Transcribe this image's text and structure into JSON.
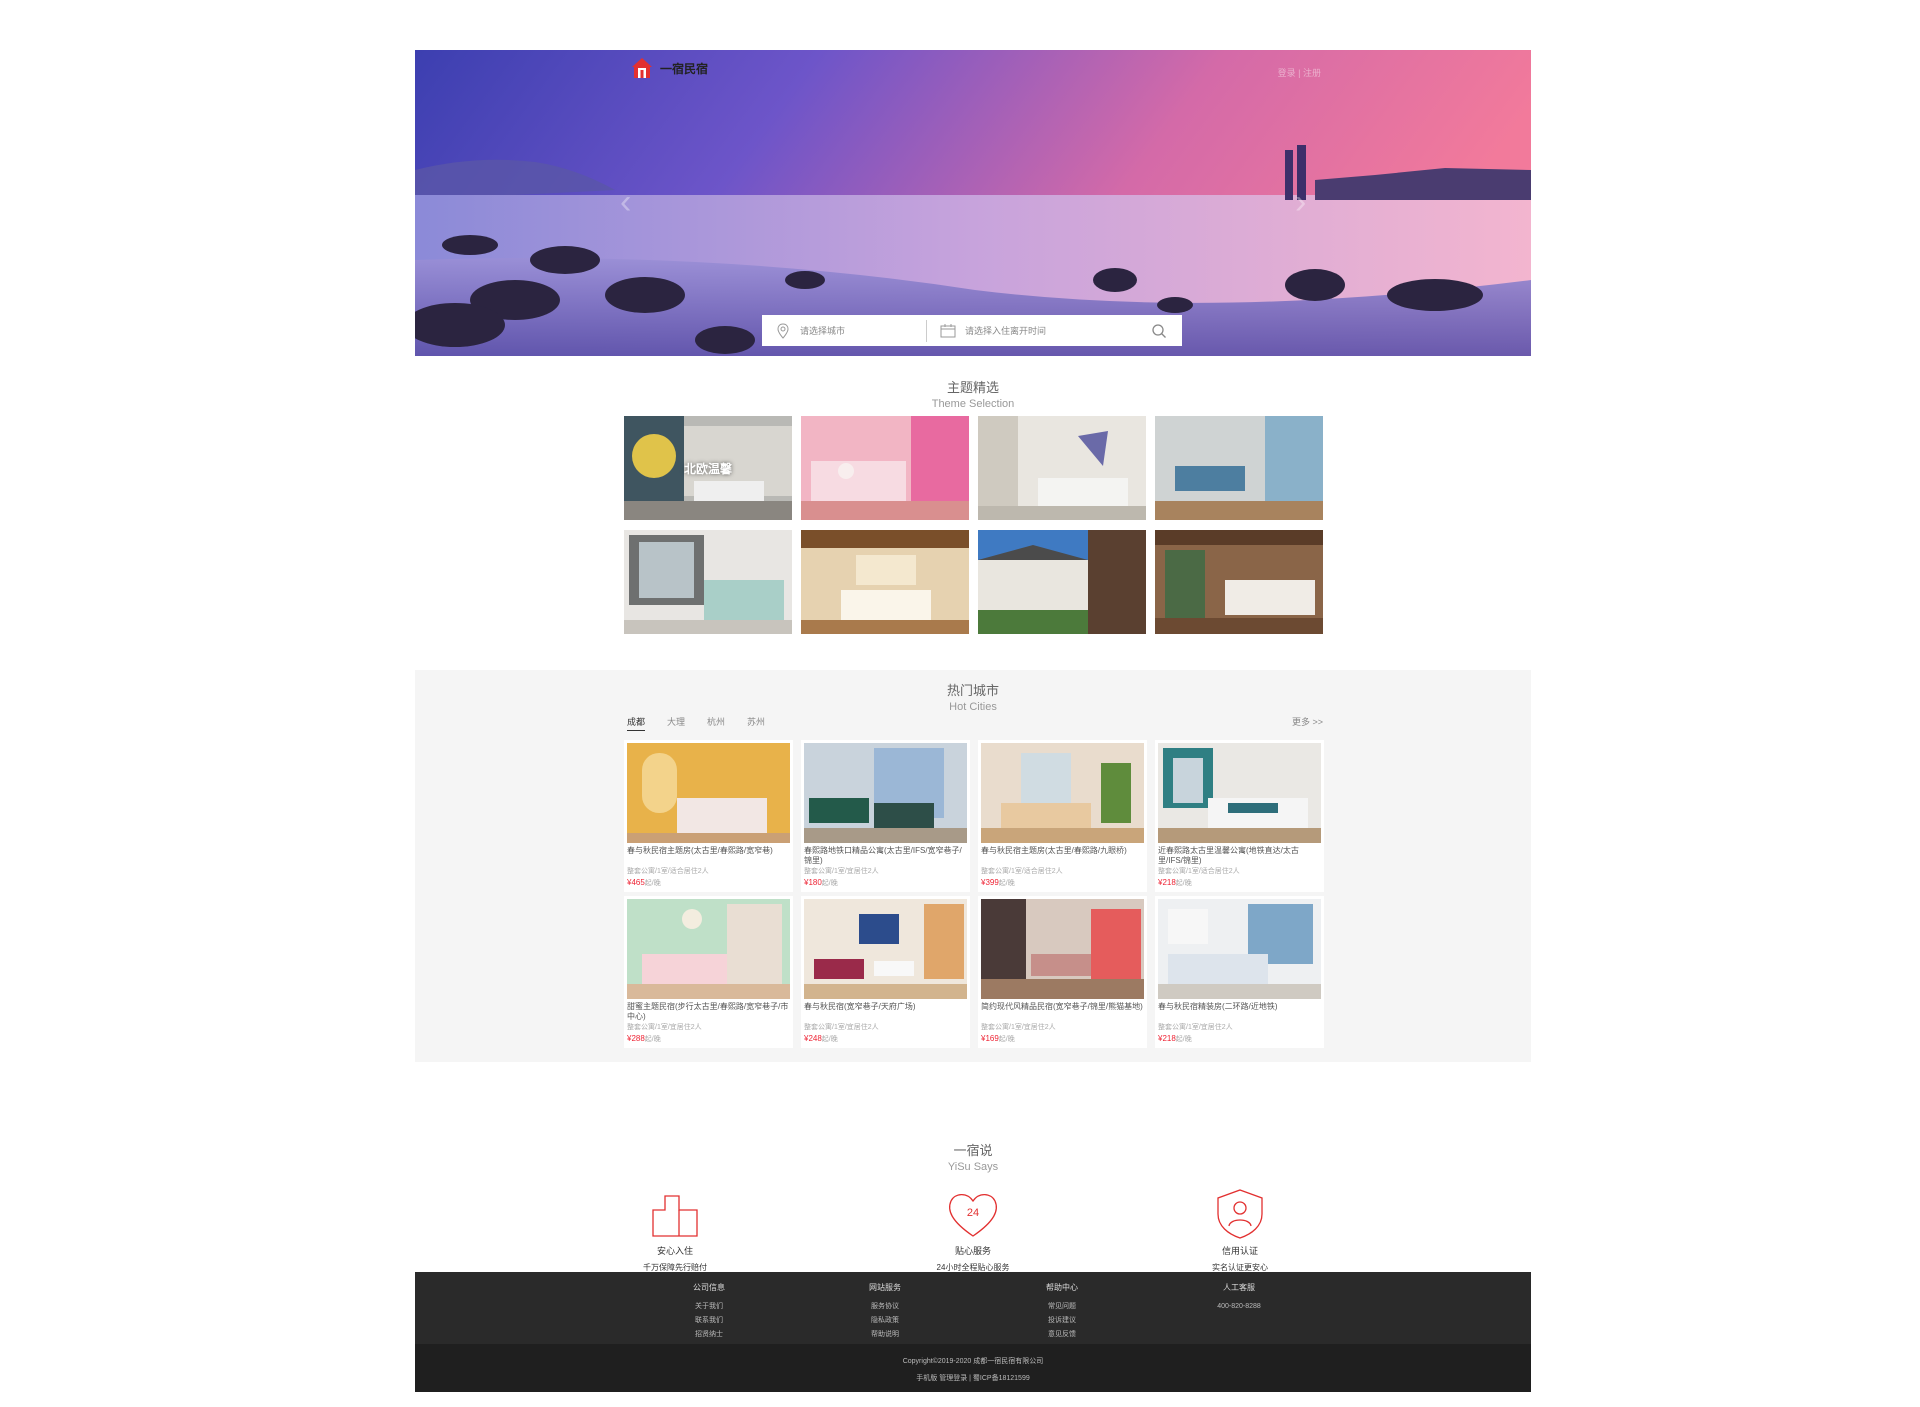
{
  "header": {
    "logo_text": "一宿民宿",
    "top_links": "登录 | 注册"
  },
  "search": {
    "city_placeholder": "请选择城市",
    "date_placeholder": "请选择入住离开时间"
  },
  "theme_section": {
    "title_cn": "主题精选",
    "title_en": "Theme Selection",
    "items": [
      {
        "label": "北欧温馨"
      },
      {
        "label": ""
      },
      {
        "label": ""
      },
      {
        "label": ""
      },
      {
        "label": ""
      },
      {
        "label": ""
      },
      {
        "label": ""
      },
      {
        "label": ""
      }
    ]
  },
  "hot_cities": {
    "title_cn": "热门城市",
    "title_en": "Hot Cities",
    "tabs": [
      "成都",
      "大理",
      "杭州",
      "苏州"
    ],
    "more": "更多 >>",
    "listings": [
      {
        "title": "春与秋民宿主题房(太古里/春熙路/宽窄巷)",
        "sub": "整套公寓/1室/适合居住2人",
        "price": "¥465",
        "unit": "起/晚"
      },
      {
        "title": "春熙路地铁口精品公寓(太古里/IFS/宽窄巷子/锦里)",
        "sub": "整套公寓/1室/宜居住2人",
        "price": "¥180",
        "unit": "起/晚"
      },
      {
        "title": "春与秋民宿主题房(太古里/春熙路/九眼桥)",
        "sub": "整套公寓/1室/适合居住2人",
        "price": "¥399",
        "unit": "起/晚"
      },
      {
        "title": "近春熙路太古里温馨公寓(地铁直达/太古里/IFS/锦里)",
        "sub": "整套公寓/1室/适合居住2人",
        "price": "¥218",
        "unit": "起/晚"
      },
      {
        "title": "甜蜜主题民宿(步行太古里/春熙路/宽窄巷子/市中心)",
        "sub": "整套公寓/1室/宜居住2人",
        "price": "¥288",
        "unit": "起/晚"
      },
      {
        "title": "春与秋民宿(宽窄巷子/天府广场)",
        "sub": "整套公寓/1室/宜居住2人",
        "price": "¥248",
        "unit": "起/晚"
      },
      {
        "title": "简约现代风精品民宿(宽窄巷子/锦里/熊猫基地)",
        "sub": "整套公寓/1室/宜居住2人",
        "price": "¥169",
        "unit": "起/晚"
      },
      {
        "title": "春与秋民宿精装房(二环路/近地铁)",
        "sub": "整套公寓/1室/宜居住2人",
        "price": "¥218",
        "unit": "起/晚"
      }
    ]
  },
  "says": {
    "title_cn": "一宿说",
    "title_en": "YiSu Says",
    "heart_number": "24",
    "features": [
      {
        "icon": "building-icon",
        "title": "安心入住",
        "desc": "千万保障先行赔付"
      },
      {
        "icon": "heart-24-icon",
        "title": "贴心服务",
        "desc": "24小时全程贴心服务"
      },
      {
        "icon": "shield-user-icon",
        "title": "信用认证",
        "desc": "实名认证更安心"
      }
    ]
  },
  "footer": {
    "columns": [
      {
        "heading": "公司信息",
        "links": [
          "关于我们",
          "联系我们",
          "招贤纳士"
        ]
      },
      {
        "heading": "网站服务",
        "links": [
          "服务协议",
          "隐私政策",
          "帮助说明"
        ]
      },
      {
        "heading": "帮助中心",
        "links": [
          "常见问题",
          "投诉建议",
          "意见反馈"
        ]
      },
      {
        "heading": "人工客服",
        "links": [
          "400-820-8288"
        ]
      }
    ],
    "copyright": "Copyright©2019-2020 成都一宿民宿有限公司",
    "icp": "手机版  管理登录 | 蜀ICP备18121599"
  },
  "colors": {
    "accent": "#e23030",
    "footer_bg": "#2a2a2a",
    "section_bg": "#f5f5f5"
  }
}
